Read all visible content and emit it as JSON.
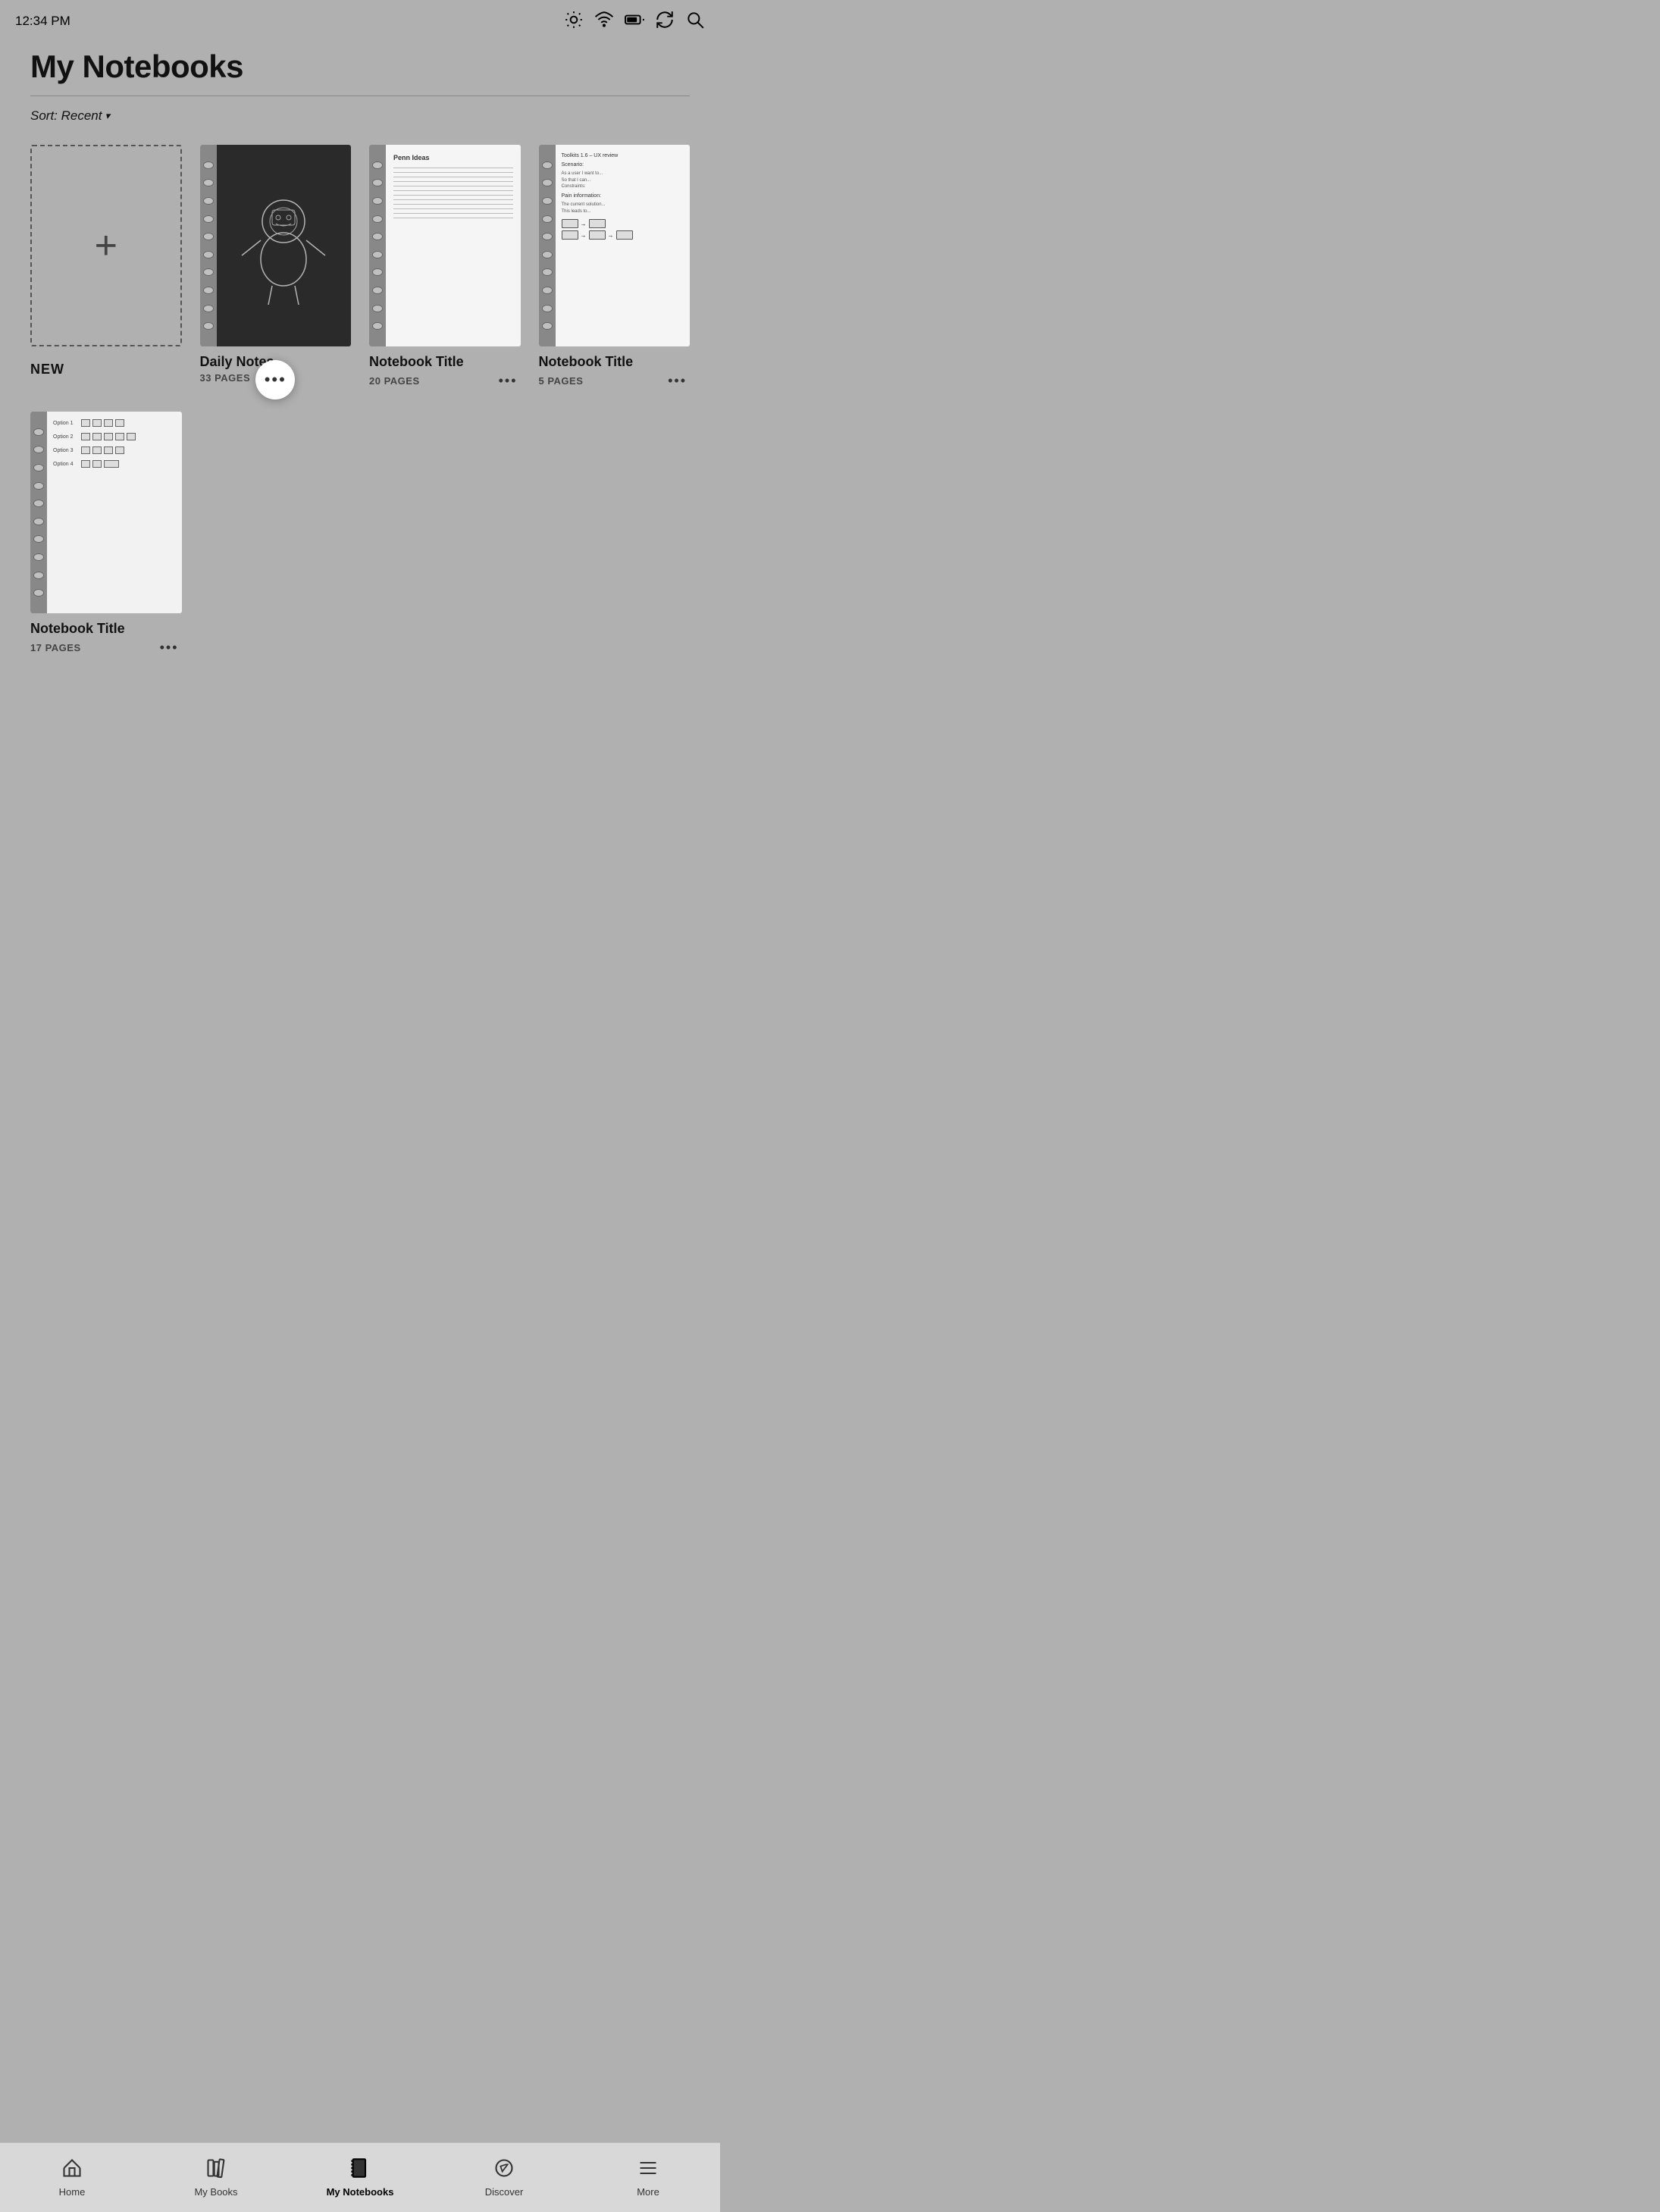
{
  "statusBar": {
    "time": "12:34 PM"
  },
  "header": {
    "title": "My Notebooks"
  },
  "sortBar": {
    "label": "Sort: Recent",
    "chevron": "▾"
  },
  "notebooks": [
    {
      "id": "new",
      "type": "new",
      "label": "NEW"
    },
    {
      "id": "daily-notes",
      "type": "mechanical",
      "title": "Daily Notes",
      "pages": "33 PAGES",
      "hasActiveMenu": true
    },
    {
      "id": "notebook-2",
      "type": "lines",
      "title": "Notebook Title",
      "pages": "20 PAGES",
      "hasActiveMenu": false
    },
    {
      "id": "notebook-3",
      "type": "toolkit",
      "title": "Notebook Title",
      "pages": "5 PAGES",
      "hasActiveMenu": false
    },
    {
      "id": "notebook-4",
      "type": "options",
      "title": "Notebook Title",
      "pages": "17 PAGES",
      "hasActiveMenu": false
    }
  ],
  "bottomNav": {
    "items": [
      {
        "id": "home",
        "label": "Home",
        "active": false
      },
      {
        "id": "mybooks",
        "label": "My Books",
        "active": false
      },
      {
        "id": "mynotebooks",
        "label": "My Notebooks",
        "active": true
      },
      {
        "id": "discover",
        "label": "Discover",
        "active": false
      },
      {
        "id": "more",
        "label": "More",
        "active": false
      }
    ]
  }
}
